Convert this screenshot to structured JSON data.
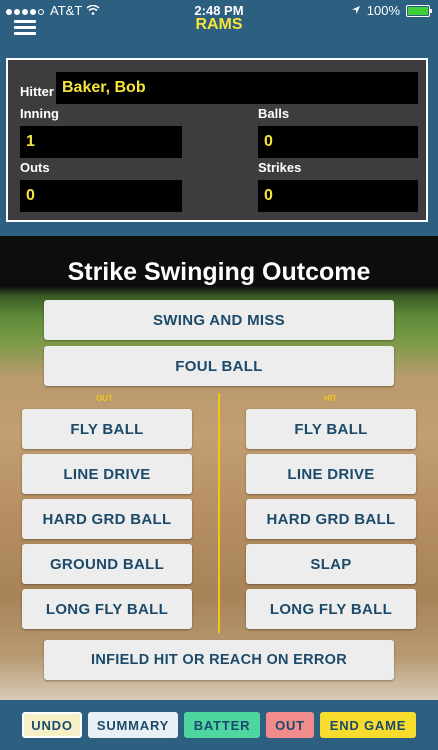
{
  "status_bar": {
    "carrier": "AT&T",
    "time": "2:48 PM",
    "battery": "100%",
    "location_icon": "location-arrow-icon",
    "wifi_icon": "wifi-icon"
  },
  "nav": {
    "title": "RAMS",
    "menu_icon": "hamburger-menu-icon"
  },
  "info": {
    "hitter_label": "Hitter",
    "hitter_value": "Baker,  Bob",
    "inning_label": "Inning",
    "inning_value": "1",
    "balls_label": "Balls",
    "balls_value": "0",
    "outs_label": "Outs",
    "outs_value": "0",
    "strikes_label": "Strikes",
    "strikes_value": "0"
  },
  "outcome": {
    "title": "Strike Swinging Outcome",
    "swing_and_miss": "SWING AND MISS",
    "foul_ball": "FOUL BALL",
    "out_label": "OUT",
    "hit_label": "HIT",
    "out_buttons": [
      "FLY BALL",
      "LINE DRIVE",
      "HARD GRD BALL",
      "GROUND BALL",
      "LONG FLY BALL"
    ],
    "hit_buttons": [
      "FLY BALL",
      "LINE DRIVE",
      "HARD GRD BALL",
      "SLAP",
      "LONG FLY BALL"
    ],
    "infield_hit": "INFIELD HIT OR REACH ON ERROR"
  },
  "toolbar": {
    "undo": "UNDO",
    "summary": "SUMMARY",
    "batter": "BATTER",
    "out": "OUT",
    "end_game": "END GAME"
  },
  "colors": {
    "nav_background": "#2c5f80",
    "title_yellow": "#f7e43b",
    "button_text": "#1c4a6a",
    "summary": "#e8f0f5",
    "batter": "#4fd6a0",
    "out": "#f28c8c",
    "end_game": "#f7dc2e",
    "undo": "#f6f0c8"
  }
}
